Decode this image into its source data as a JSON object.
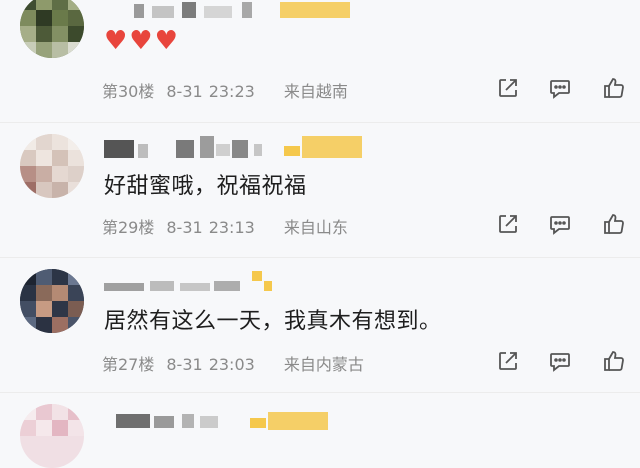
{
  "comments": [
    {
      "floor": "第30楼",
      "date": "8-31",
      "time": "23:23",
      "location": "来自越南",
      "content": "❤️❤️❤️",
      "hearts": "♥♥♥"
    },
    {
      "floor": "第29楼",
      "date": "8-31",
      "time": "23:13",
      "location": "来自山东",
      "content": "好甜蜜哦，祝福祝福"
    },
    {
      "floor": "第27楼",
      "date": "8-31",
      "time": "23:03",
      "location": "来自内蒙古",
      "content": "居然有这么一天，我真木有想到。"
    }
  ],
  "colors": {
    "background": "#f7f8fa",
    "meta_text": "#8a8a8a",
    "heart": "#e8453c",
    "vip_badge": "#f5c84c"
  },
  "icons": {
    "share": "share-icon",
    "comment": "comment-icon",
    "like": "thumbs-up-icon"
  }
}
